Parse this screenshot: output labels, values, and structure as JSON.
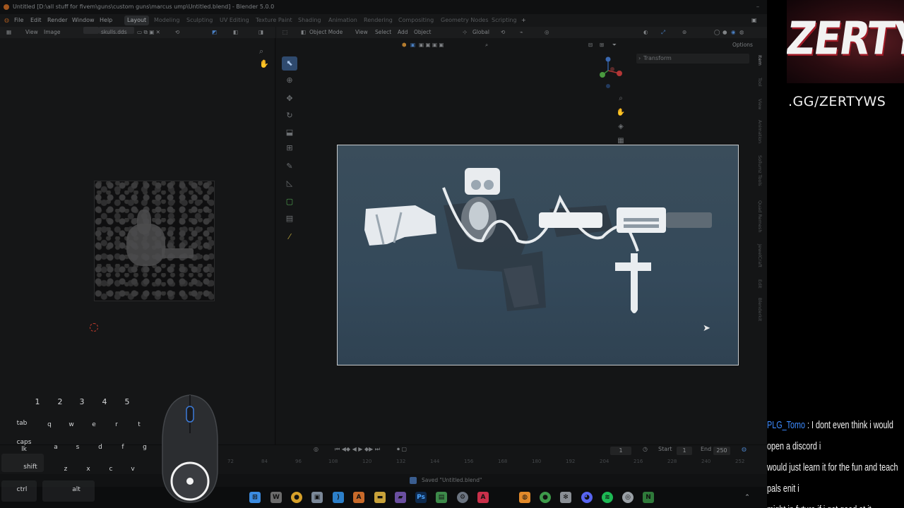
{
  "window": {
    "title": "Untitled [D:\\all stuff for fivem\\guns\\custom guns\\marcus ump\\Untitled.blend] - Blender 5.0.0"
  },
  "menu": [
    "File",
    "Edit",
    "Render",
    "Window",
    "Help"
  ],
  "workspace_tabs": [
    "Layout",
    "Modeling",
    "Sculpting",
    "UV Editing",
    "Texture Paint",
    "Shading",
    "Animation",
    "Rendering",
    "Compositing",
    "Geometry Nodes",
    "Scripting"
  ],
  "active_workspace": "Layout",
  "image_editor": {
    "view": "View",
    "image": "Image",
    "image_name": "skulls.dds"
  },
  "viewport": {
    "mode": "Object Mode",
    "menus": [
      "View",
      "Select",
      "Add",
      "Object"
    ],
    "orientation": "Global",
    "options": "Options",
    "transform_panel": "Transform",
    "side_tabs": [
      "Item",
      "Tool",
      "View",
      "Animation",
      "Sollumz Tools",
      "Quad Remesh",
      "JewelCraft",
      "Edit",
      "Blenderkit"
    ]
  },
  "timeline": {
    "current_frame": "1",
    "start_label": "Start",
    "start": "1",
    "end_label": "End",
    "end": "250",
    "ruler": [
      "72",
      "84",
      "96",
      "108",
      "120",
      "132",
      "144",
      "156",
      "168",
      "180",
      "192",
      "204",
      "216",
      "228",
      "240",
      "252"
    ]
  },
  "status": {
    "message": "Saved \"Untitled.blend\""
  },
  "keyboard_overlay": {
    "numbers": [
      "1",
      "2",
      "3",
      "4",
      "5"
    ],
    "row_tab": [
      "tab",
      "q",
      "w",
      "e",
      "r",
      "t"
    ],
    "row_caps_line1": "caps",
    "row_caps_line2": "lk",
    "row_caps": [
      "a",
      "s",
      "d",
      "f",
      "g"
    ],
    "row_shift": [
      "shift",
      "z",
      "x",
      "c",
      "v"
    ],
    "row_ctrl": [
      "ctrl",
      "alt"
    ]
  },
  "stream_overlay": {
    "logo": "ZERTY",
    "link": ".GG/ZERTYWS",
    "chat": {
      "user": "PLG_Tomo",
      "lines": [
        " : I dont even think i would open a discord i",
        "would just learn it for the fun and teach pals enit i",
        "might in future if i get good at it"
      ]
    }
  },
  "colors": {
    "accent_active": "#2f4a6e",
    "chat_user": "#3d8bff",
    "logo_red": "#a01b27"
  }
}
